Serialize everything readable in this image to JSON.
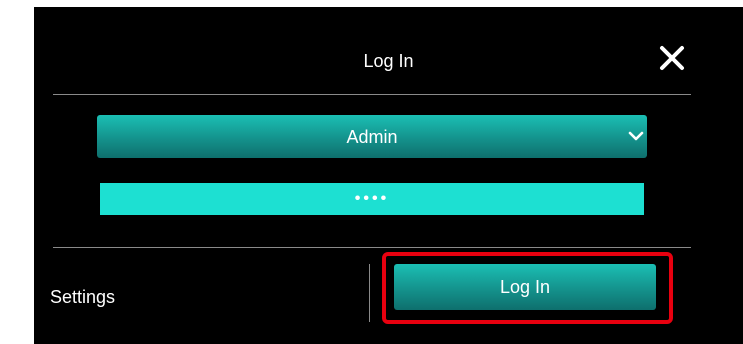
{
  "dialog": {
    "title": "Log In",
    "close_icon": "close-icon"
  },
  "form": {
    "user_select": {
      "selected": "Admin",
      "icon": "chevron-down-icon"
    },
    "password": {
      "value": "••••"
    }
  },
  "footer": {
    "settings_label": "Settings",
    "login_label": "Log In"
  },
  "colors": {
    "background": "#000000",
    "accent": "#1bbfb4",
    "password_field": "#1de0d2",
    "highlight": "#e8000f",
    "divider": "#8a8a8a"
  }
}
